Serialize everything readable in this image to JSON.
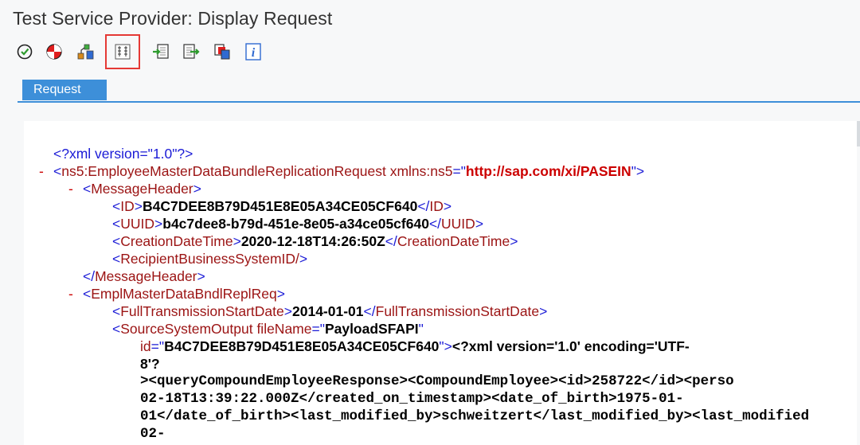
{
  "window": {
    "title": "Test Service Provider: Display Request"
  },
  "toolbar": {
    "icons": [
      "check-icon",
      "stop-icon",
      "hierarchy-icon",
      "display-format-icon",
      "import-icon",
      "export-icon",
      "copy-icon",
      "info-icon"
    ]
  },
  "tabs": [
    {
      "label": "Request",
      "active": true
    }
  ],
  "xml": {
    "decl": "<?xml version=\"1.0\"?>",
    "root_tag": "ns5:EmployeeMasterDataBundleReplicationRequest",
    "root_attr": "xmlns:ns5",
    "root_url": "http://sap.com/xi/PASEIN",
    "header_tag": "MessageHeader",
    "id_tag": "ID",
    "id_value": "B4C7DEE8B79D451E8E05A34CE05CF640",
    "uuid_tag": "UUID",
    "uuid_value": "b4c7dee8-b79d-451e-8e05-a34ce05cf640",
    "cdt_tag": "CreationDateTime",
    "cdt_value": "2020-12-18T14:26:50Z",
    "rbs_tag": "RecipientBusinessSystemID/",
    "header_close": "MessageHeader",
    "bundle_tag": "EmplMasterDataBndlReplReq",
    "fts_tag": "FullTransmissionStartDate",
    "fts_value": "2014-01-01",
    "sso_tag": "SourceSystemOutput",
    "sso_attr1": "fileName",
    "sso_attr1_value": "PayloadSFAPI",
    "sso_attr2": "id",
    "sso_attr2_value": "B4C7DEE8B79D451E8E05A34CE05CF640",
    "payload_1": "<?xml version='1.0' encoding='UTF-",
    "payload_2": "8'?",
    "payload_3": "><queryCompoundEmployeeResponse><CompoundEmployee><id>258722</id><perso",
    "payload_4": "02-18T13:39:22.000Z</created_on_timestamp><date_of_birth>1975-01-",
    "payload_5": "01</date_of_birth><last_modified_by>schweitzert</last_modified_by><last_modified",
    "payload_6": "02-"
  }
}
